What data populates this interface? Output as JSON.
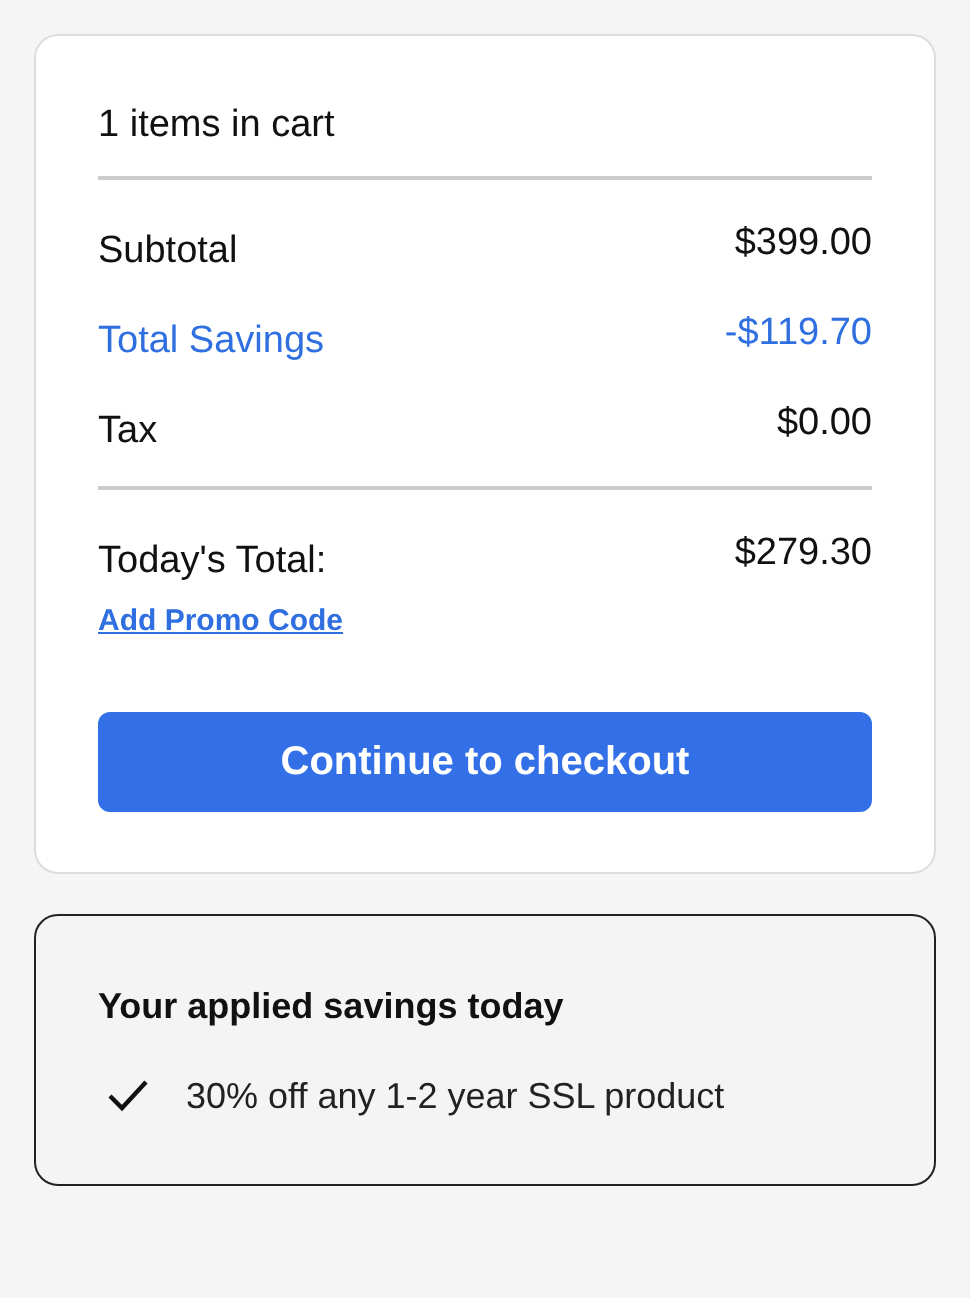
{
  "cart": {
    "count_label": "1 items in cart",
    "lines": [
      {
        "kind": "normal",
        "label": "Subtotal",
        "amount": "$399.00"
      },
      {
        "kind": "savings",
        "label": "Total Savings",
        "amount": "-$119.70"
      },
      {
        "kind": "normal",
        "label": "Tax",
        "amount": "$0.00"
      }
    ],
    "total": {
      "label": "Today's Total:",
      "amount": "$279.30"
    },
    "promo_link": "Add Promo Code",
    "checkout_button": "Continue to checkout"
  },
  "savings": {
    "title": "Your applied savings today",
    "items": [
      "30% off any 1-2 year SSL product"
    ]
  }
}
